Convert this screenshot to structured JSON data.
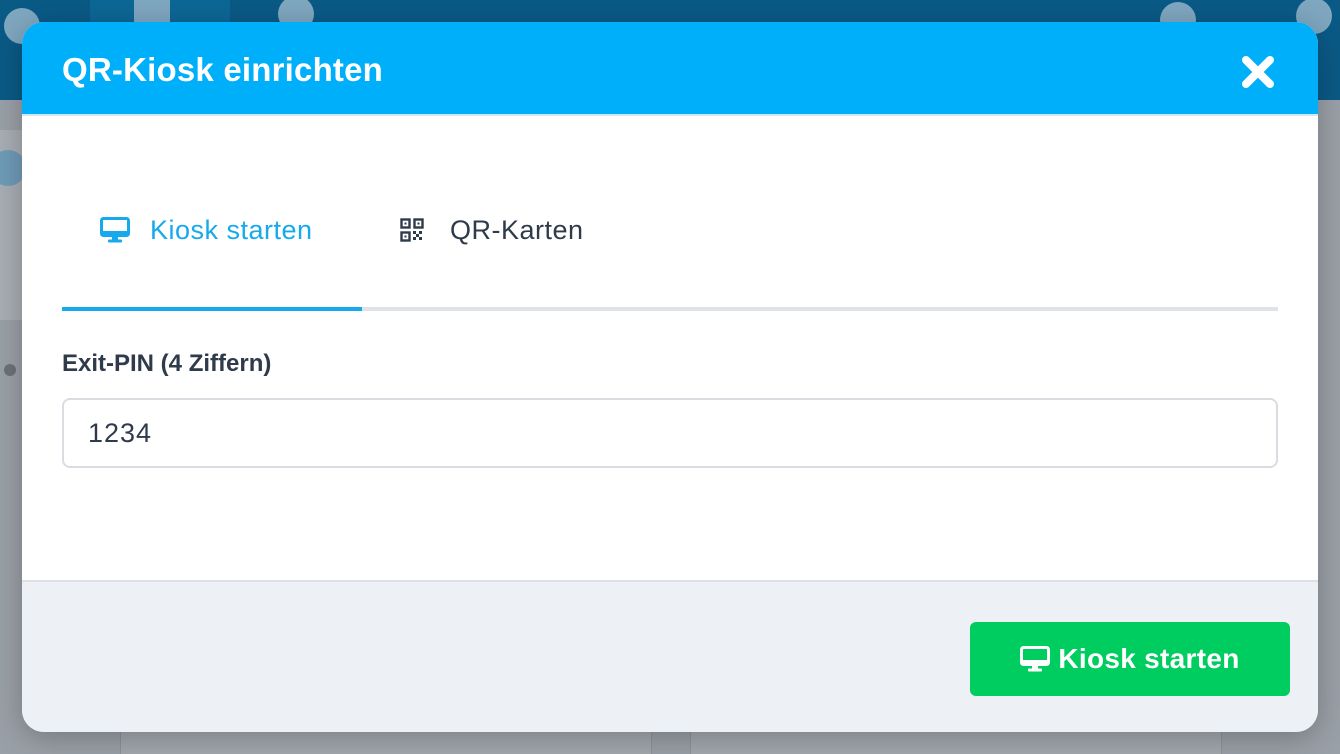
{
  "modal": {
    "title": "QR-Kiosk einrichten",
    "close_icon": "close-icon"
  },
  "tabs": [
    {
      "label": "Kiosk starten",
      "icon": "monitor-icon",
      "active": true
    },
    {
      "label": "QR-Karten",
      "icon": "qr-code-icon",
      "active": false
    }
  ],
  "form": {
    "pin_label": "Exit-PIN (4 Ziffern)",
    "pin_value": "1234"
  },
  "footer": {
    "start_label": "Kiosk starten",
    "start_icon": "monitor-icon"
  },
  "colors": {
    "header": "#00aff9",
    "accent": "#16a9ec",
    "primary_button": "#00cd5f",
    "footer_bg": "#edf0f5"
  }
}
